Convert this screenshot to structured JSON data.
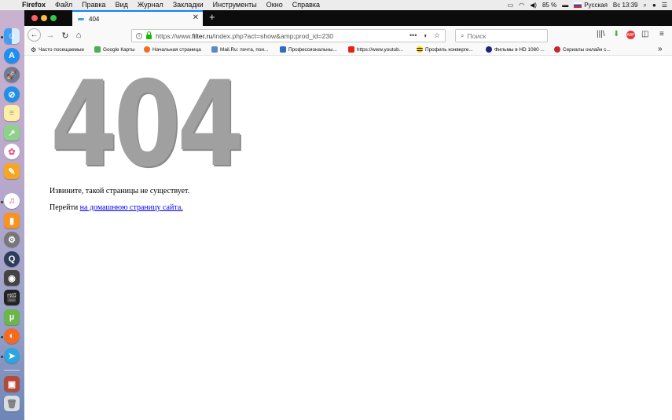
{
  "menubar": {
    "app": "Firefox",
    "items": [
      "Файл",
      "Правка",
      "Вид",
      "Журнал",
      "Закладки",
      "Инструменты",
      "Окно",
      "Справка"
    ],
    "battery": "85 %",
    "input_source": "Русская",
    "clock": "Вс 13:39"
  },
  "dock": {
    "icons": [
      "finder-icon",
      "app-store-icon",
      "launchpad-icon",
      "safari-icon",
      "notes-icon",
      "maps-icon",
      "photos-icon",
      "pages-icon",
      "itunes-icon",
      "ibooks-icon",
      "system-preferences-icon",
      "quicktime-icon",
      "disk-utility-icon",
      "final-cut-icon",
      "utorrent-icon",
      "firefox-icon",
      "telegram-icon",
      "photo-booth-icon",
      "trash-icon"
    ]
  },
  "browser": {
    "tab_title": "404",
    "url_host": "https://www.filter.ru",
    "url_host_bold": "filter.ru",
    "url_prefix": "https://www.",
    "url_path": "/index.php?act=show&amp;prod_id=230",
    "search_placeholder": "Поиск",
    "bookmarks": [
      "Часто посещаемые",
      "Google Карты",
      "Начальная страница",
      "Mail.Ru: почта, пои...",
      "Профессиональны...",
      "https://www.youtub...",
      "Профиль конверге...",
      "Фильмы в HD 1080 ...",
      "Сериалы онлайн с..."
    ]
  },
  "page": {
    "error_code": "404",
    "message": "Извините, такой страницы не существует.",
    "goto_prefix": "Перейти ",
    "goto_link": "на домашнюю страницу сайта."
  }
}
